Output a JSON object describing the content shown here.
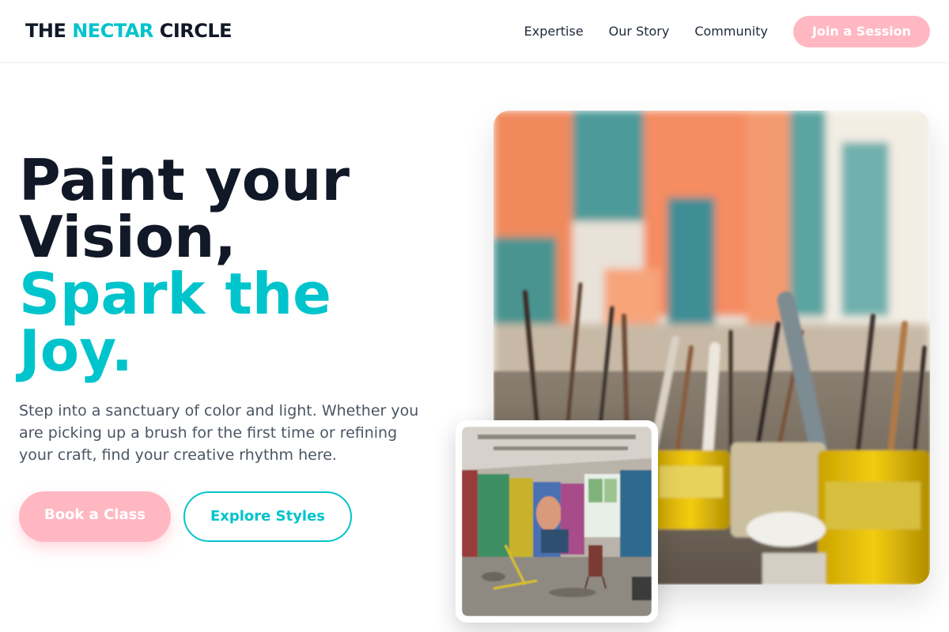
{
  "header": {
    "logo_part1": "THE ",
    "logo_accent": "NECTAR",
    "logo_part2": " CIRCLE",
    "nav": [
      "Expertise",
      "Our Story",
      "Community"
    ],
    "cta_label": "Join a Session"
  },
  "hero": {
    "title_line1": "Paint your",
    "title_line2": "Vision,",
    "title_line3": "Spark the",
    "title_line4": "Joy.",
    "description": "Step into a sanctuary of color and light. Whether you are picking up a brush for the first time or refining your craft, find your creative rhythm here.",
    "primary_button": "Book a Class",
    "secondary_button": "Explore Styles"
  },
  "colors": {
    "accent": "#00c4cc",
    "pink": "#ffb8c2",
    "heading": "#111827",
    "body": "#4b5563"
  }
}
